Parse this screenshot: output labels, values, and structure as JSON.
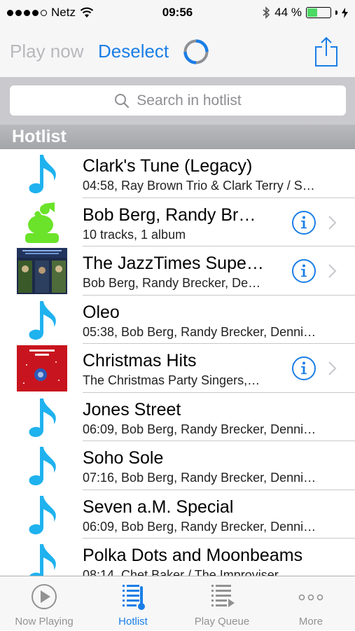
{
  "status_bar": {
    "carrier": "Netz",
    "time": "09:56",
    "battery_percent": "44 %",
    "battery_level": 0.44,
    "signal_bars": 4
  },
  "toolbar": {
    "play_now_label": "Play now",
    "deselect_label": "Deselect"
  },
  "search": {
    "placeholder": "Search in hotlist"
  },
  "section": {
    "title": "Hotlist"
  },
  "items": [
    {
      "title": "Clark's Tune (Legacy)",
      "subtitle": "04:58, Ray Brown Trio & Clark Terry / S…",
      "thumb": "music-note-icon",
      "has_info": false
    },
    {
      "title": "Bob Berg, Randy Br…",
      "subtitle": "10 tracks, 1 album",
      "thumb": "artist-icon",
      "has_info": true
    },
    {
      "title": "The JazzTimes Supe…",
      "subtitle": "Bob Berg, Randy Brecker, De…",
      "thumb": "album-cover-jazztimes",
      "has_info": true
    },
    {
      "title": "Oleo",
      "subtitle": "05:38, Bob Berg, Randy Brecker, Denni…",
      "thumb": "music-note-icon",
      "has_info": false
    },
    {
      "title": "Christmas Hits",
      "subtitle": "The Christmas Party Singers,…",
      "thumb": "album-cover-christmas",
      "has_info": true
    },
    {
      "title": "Jones Street",
      "subtitle": "06:09, Bob Berg, Randy Brecker, Denni…",
      "thumb": "music-note-icon",
      "has_info": false
    },
    {
      "title": "Soho Sole",
      "subtitle": "07:16, Bob Berg, Randy Brecker, Denni…",
      "thumb": "music-note-icon",
      "has_info": false
    },
    {
      "title": "Seven a.M. Special",
      "subtitle": "06:09, Bob Berg, Randy Brecker, Denni…",
      "thumb": "music-note-icon",
      "has_info": false
    },
    {
      "title": "Polka Dots and Moonbeams",
      "subtitle": "08:14, Chet Baker / The Improviser",
      "thumb": "music-note-icon",
      "has_info": false
    }
  ],
  "tabs": [
    {
      "label": "Now Playing",
      "icon": "play-circle-icon",
      "active": false
    },
    {
      "label": "Hotlist",
      "icon": "hotlist-icon",
      "active": true
    },
    {
      "label": "Play Queue",
      "icon": "play-queue-icon",
      "active": false
    },
    {
      "label": "More",
      "icon": "more-icon",
      "active": false
    }
  ],
  "colors": {
    "accent": "#1a7ee6",
    "note": "#1fb2ef",
    "artist": "#6be32a",
    "inactive": "#929292"
  }
}
